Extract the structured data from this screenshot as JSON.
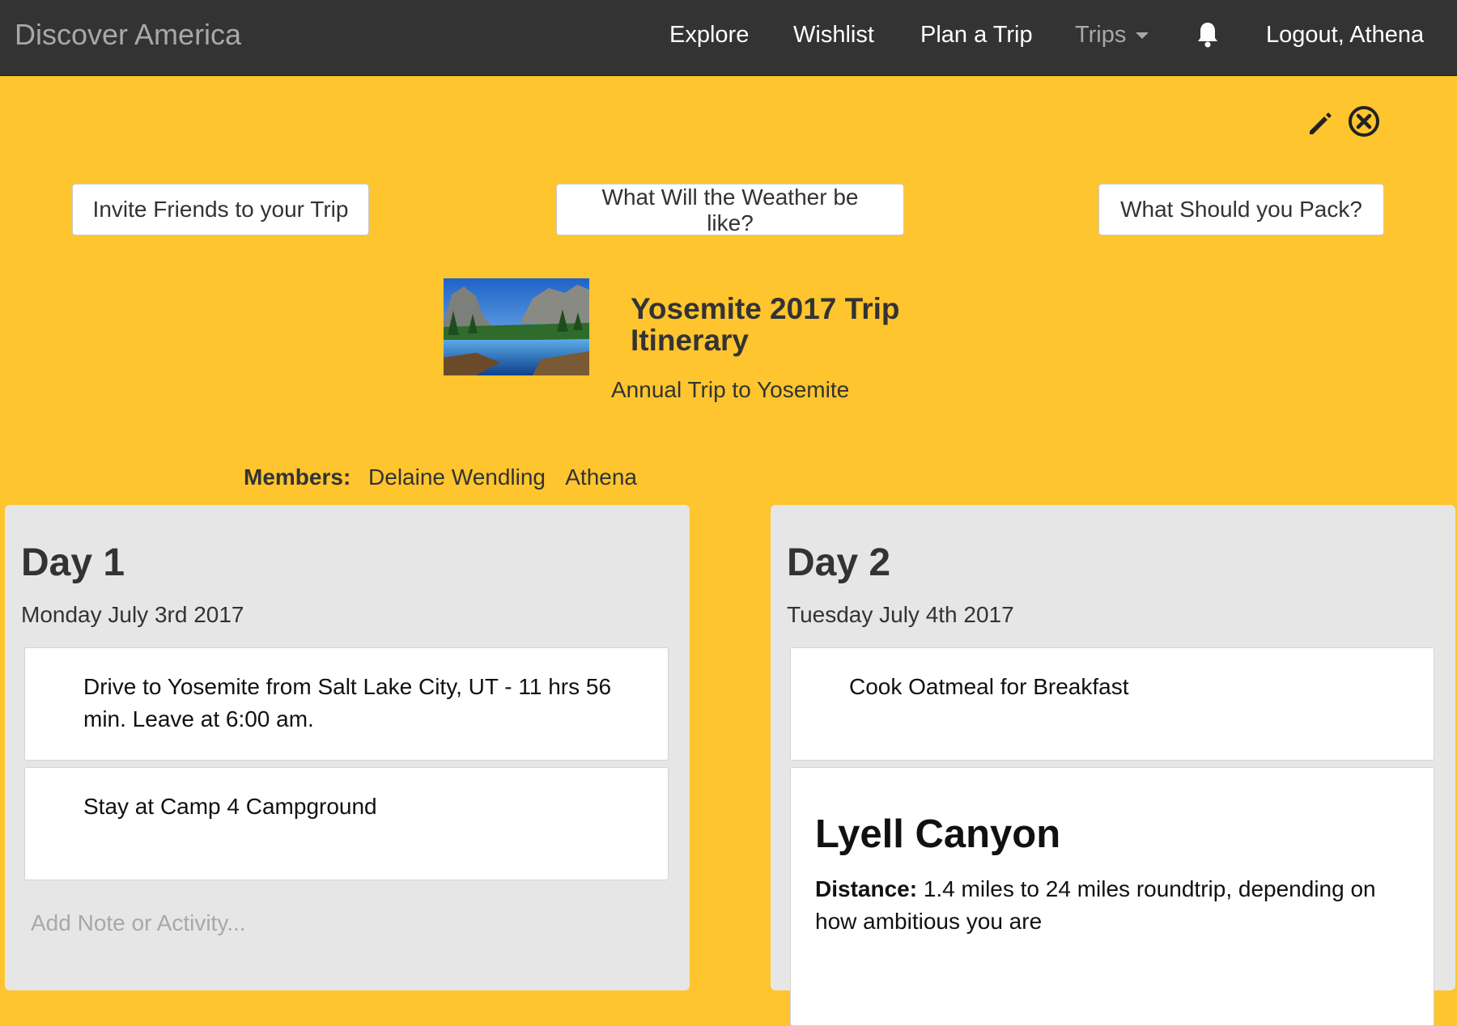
{
  "navbar": {
    "brand": "Discover America",
    "items": [
      {
        "label": "Explore"
      },
      {
        "label": "Wishlist"
      },
      {
        "label": "Plan a Trip"
      },
      {
        "label": "Trips"
      }
    ],
    "logout_label": "Logout, Athena",
    "bell_icon": "bell-icon"
  },
  "toolbar": {
    "edit_icon": "pencil-icon",
    "close_icon": "close-circle-icon"
  },
  "actions": {
    "invite_label": "Invite Friends to your Trip",
    "weather_label": "What Will the Weather be like?",
    "pack_label": "What Should you Pack?"
  },
  "trip": {
    "title": "Yosemite 2017 Trip Itinerary",
    "subtitle": "Annual Trip to Yosemite",
    "members_label": "Members:",
    "members": [
      "Delaine Wendling",
      "Athena"
    ]
  },
  "days": [
    {
      "title": "Day 1",
      "date": "Monday July 3rd 2017",
      "activities": [
        "Drive to Yosemite from Salt Lake City, UT - 11 hrs 56 min. Leave at 6:00 am.",
        "Stay at Camp 4 Campground"
      ],
      "add_note_placeholder": "Add Note or Activity..."
    },
    {
      "title": "Day 2",
      "date": "Tuesday July 4th 2017",
      "activities": [
        "Cook Oatmeal for Breakfast"
      ],
      "hike": {
        "title": "Lyell Canyon",
        "distance_label": "Distance:",
        "distance_text": "1.4 miles to 24 miles roundtrip, depending on how ambitious you are"
      }
    }
  ],
  "colors": {
    "navbar_bg": "#333333",
    "page_bg": "#fec52e",
    "card_bg": "#e6e6e6"
  }
}
